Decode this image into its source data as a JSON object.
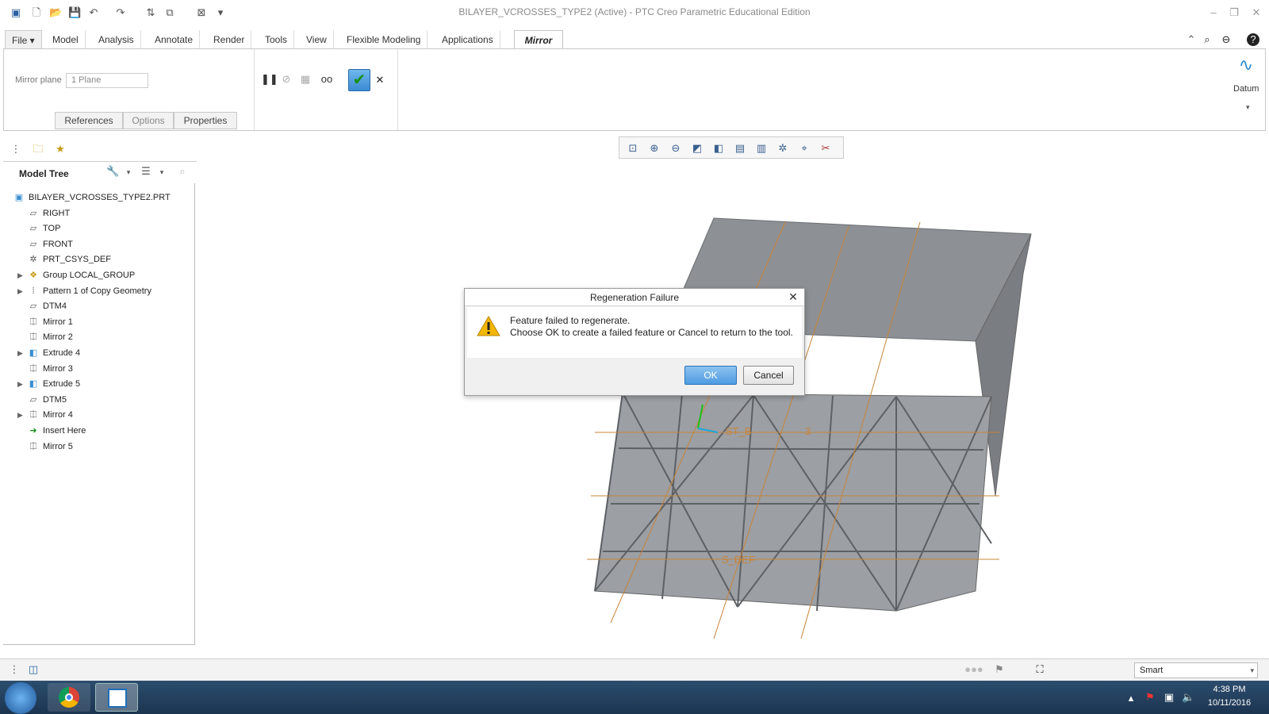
{
  "window": {
    "title": "BILAYER_VCROSSES_TYPE2 (Active) - PTC Creo Parametric Educational Edition"
  },
  "ribbon": {
    "tabs": [
      "File ▾",
      "Model",
      "Analysis",
      "Annotate",
      "Render",
      "Tools",
      "View",
      "Flexible Modeling",
      "Applications",
      "Mirror"
    ],
    "active_tab": "Mirror",
    "mirror_plane_label": "Mirror plane",
    "mirror_plane_value": "1 Plane",
    "subtabs": [
      "References",
      "Options",
      "Properties"
    ],
    "datum_label": "Datum"
  },
  "model_tree": {
    "title": "Model Tree",
    "items": [
      {
        "label": "BILAYER_VCROSSES_TYPE2.PRT",
        "icon": "part-icon",
        "expandable": false
      },
      {
        "label": "RIGHT",
        "icon": "datum-plane-icon",
        "expandable": false
      },
      {
        "label": "TOP",
        "icon": "datum-plane-icon",
        "expandable": false
      },
      {
        "label": "FRONT",
        "icon": "datum-plane-icon",
        "expandable": false
      },
      {
        "label": "PRT_CSYS_DEF",
        "icon": "csys-icon",
        "expandable": false
      },
      {
        "label": "Group LOCAL_GROUP",
        "icon": "group-icon",
        "expandable": true
      },
      {
        "label": "Pattern 1 of Copy Geometry",
        "icon": "pattern-icon",
        "expandable": true
      },
      {
        "label": "DTM4",
        "icon": "datum-plane-icon",
        "expandable": false
      },
      {
        "label": "Mirror 1",
        "icon": "mirror-icon",
        "expandable": false
      },
      {
        "label": "Mirror 2",
        "icon": "mirror-icon",
        "expandable": false
      },
      {
        "label": "Extrude 4",
        "icon": "extrude-icon",
        "expandable": true
      },
      {
        "label": "Mirror 3",
        "icon": "mirror-icon",
        "expandable": false
      },
      {
        "label": "Extrude 5",
        "icon": "extrude-icon",
        "expandable": true
      },
      {
        "label": "DTM5",
        "icon": "datum-plane-icon",
        "expandable": false
      },
      {
        "label": "Mirror 4",
        "icon": "mirror-icon",
        "expandable": true
      },
      {
        "label": "Insert Here",
        "icon": "insert-arrow-icon",
        "expandable": false
      },
      {
        "label": "Mirror 5",
        "icon": "mirror-icon",
        "expandable": false
      }
    ]
  },
  "dialog": {
    "title": "Regeneration Failure",
    "line1": "Feature failed to regenerate.",
    "line2": "Choose OK to create a failed feature or Cancel to return to the tool.",
    "ok_label": "OK",
    "cancel_label": "Cancel"
  },
  "viewport_labels": {
    "label_a": "ST_B",
    "label_b": "3",
    "label_c": "S_DEF"
  },
  "statusbar": {
    "filter_value": "Smart"
  },
  "taskbar": {
    "time": "4:38 PM",
    "date": "10/11/2016"
  },
  "colors": {
    "accent": "#4f9be0",
    "part_gray": "#8a8d91",
    "warning": "#f2b705",
    "datum_orange": "#c8843a"
  }
}
